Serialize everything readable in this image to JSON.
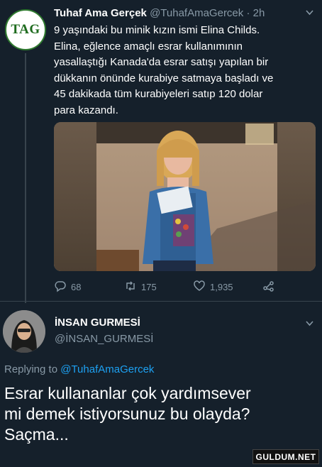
{
  "tweet": {
    "avatar_text": "TAG",
    "display_name": "Tuhaf Ama Gerçek",
    "handle": "@TuhafAmaGercek",
    "separator": "·",
    "time": "2h",
    "text": "9 yaşındaki bu minik kızın ismi Elina Childs.\nElina, eğlence amaçlı esrar kullanımının\nyasallaştığı Kanada'da esrar satışı yapılan bir\ndükkanın önünde kurabiye satmaya başladı ve\n45 dakikada tüm kurabiyeleri satıp 120 dolar\npara kazandı.",
    "actions": {
      "reply_count": "68",
      "retweet_count": "175",
      "like_count": "1,935"
    },
    "icons": [
      "reply-icon",
      "retweet-icon",
      "like-icon",
      "share-icon",
      "chevron-down-icon"
    ]
  },
  "reply": {
    "display_name": "İNSAN GURMESİ",
    "handle": "@İNSAN_GURMESİ",
    "replying_prefix": "Replying to",
    "replying_to": "@TuhafAmaGercek",
    "text": "Esrar kullananlar çok yardımsever\nmi demek istiyorsunuz bu olayda?\nSaçma..."
  },
  "watermark": "GULDUM.NET",
  "colors": {
    "background": "#15202b",
    "secondary_text": "#8899a6",
    "link": "#1da1f2",
    "divider": "#38444d"
  }
}
